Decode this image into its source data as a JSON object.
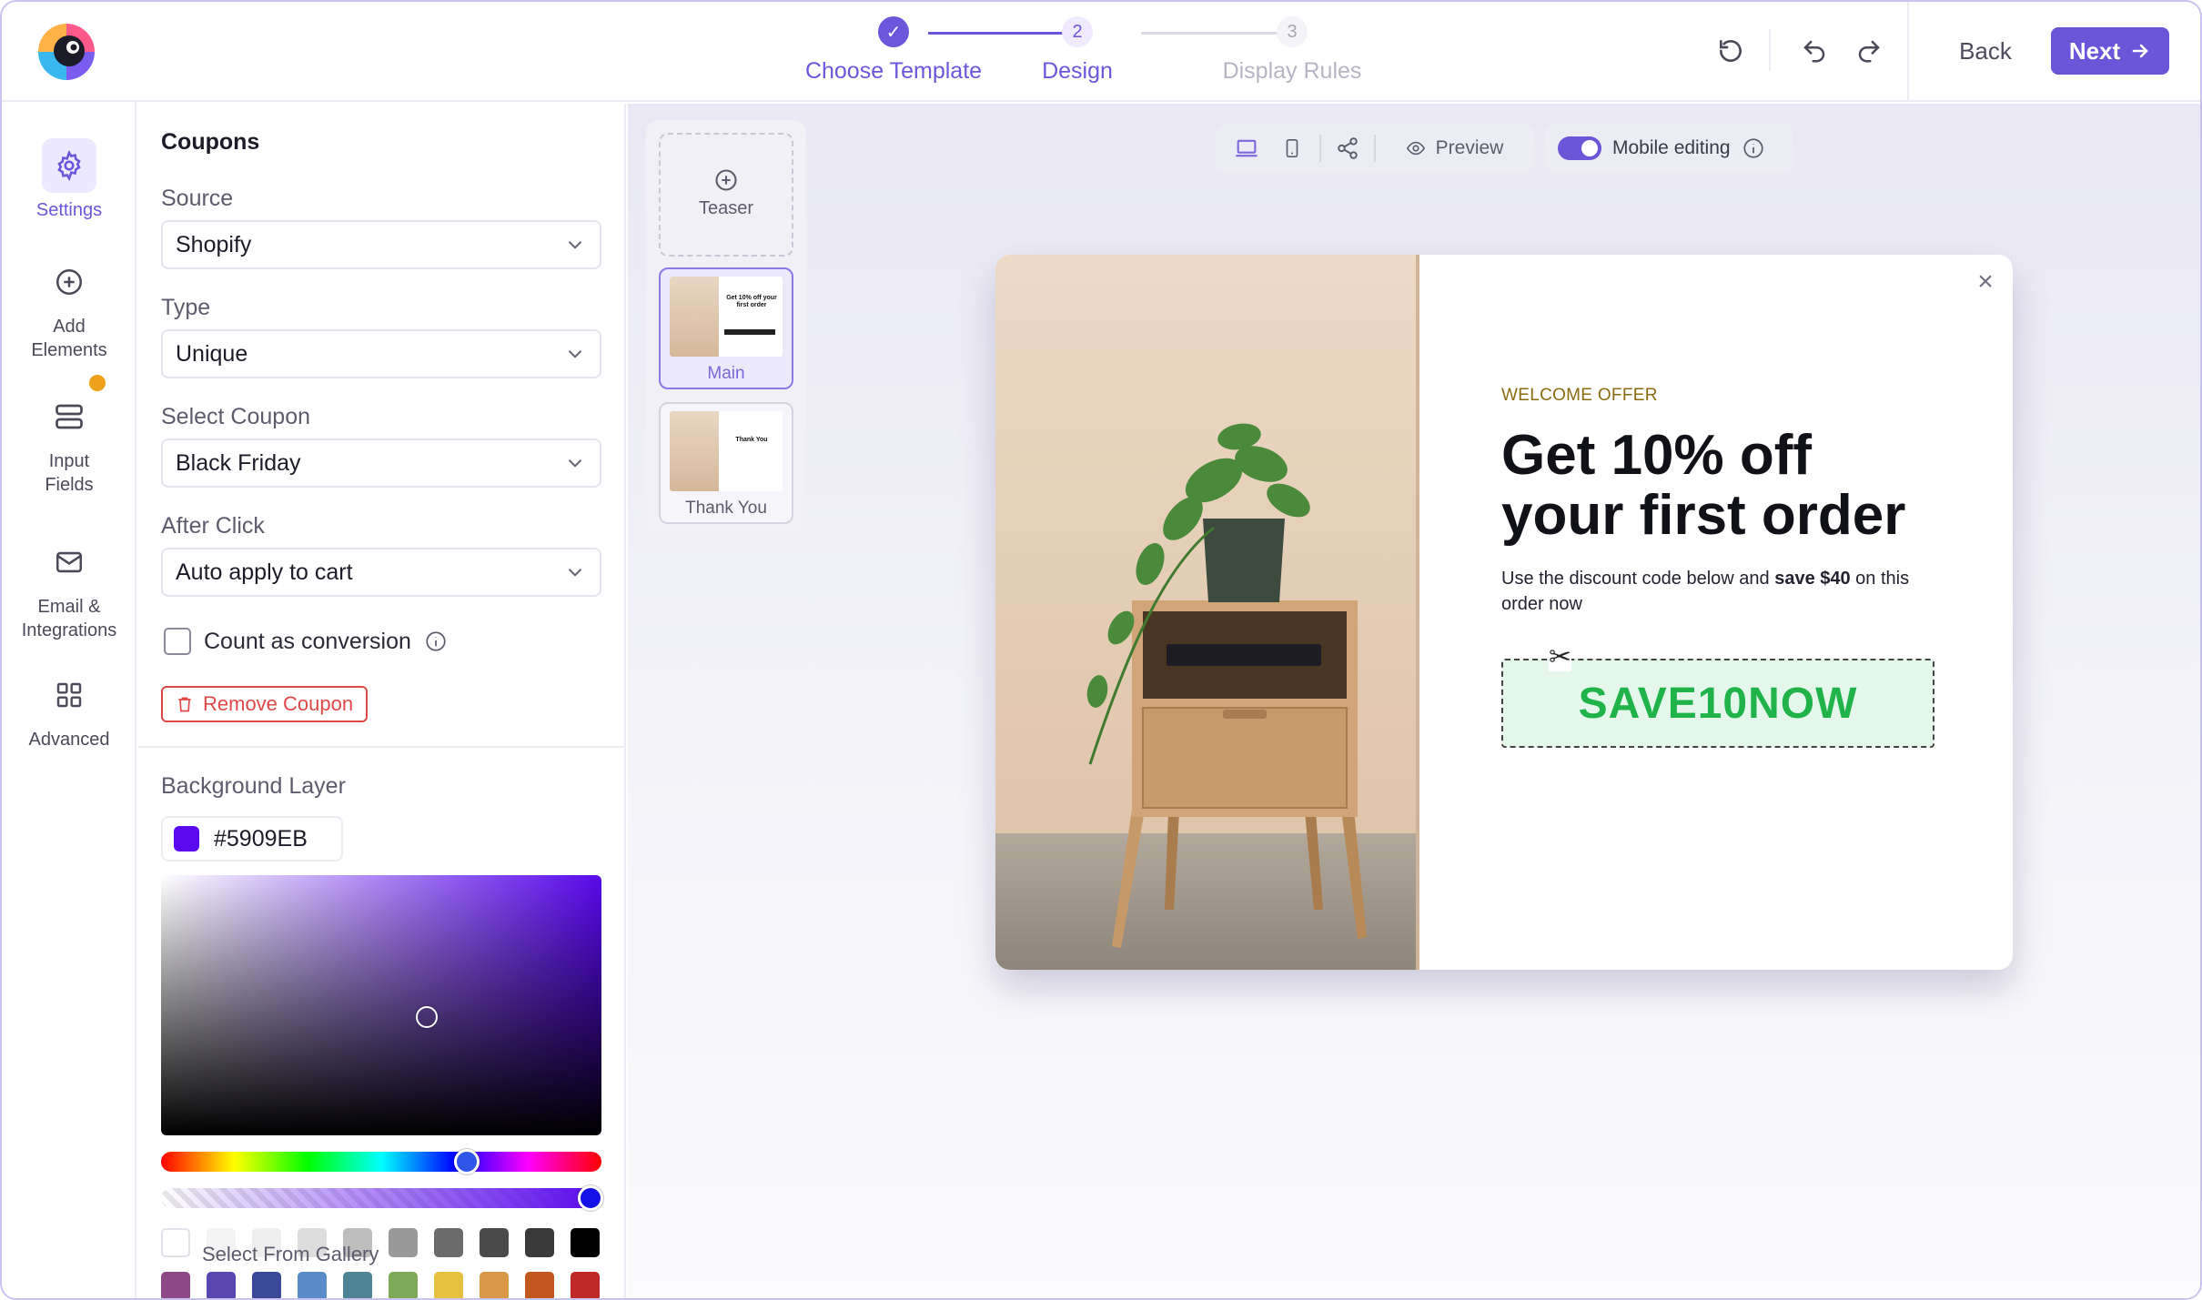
{
  "header": {
    "steps": [
      {
        "number": "✓",
        "label": "Choose Template"
      },
      {
        "number": "2",
        "label": "Design"
      },
      {
        "number": "3",
        "label": "Display Rules"
      }
    ],
    "back_label": "Back",
    "next_label": "Next",
    "icons": [
      "reset-icon",
      "undo-icon",
      "redo-icon"
    ]
  },
  "rail": {
    "items": [
      {
        "label": "Settings",
        "icon": "gear-icon"
      },
      {
        "label": "Add Elements",
        "icon": "plus-circle-icon"
      },
      {
        "label": "Input Fields",
        "icon": "input-fields-icon"
      },
      {
        "label": "Email & Integrations",
        "icon": "mail-icon"
      },
      {
        "label": "Advanced",
        "icon": "grid-icon"
      }
    ]
  },
  "panel": {
    "title": "Coupons",
    "fields": [
      {
        "label": "Source",
        "value": "Shopify"
      },
      {
        "label": "Type",
        "value": "Unique"
      },
      {
        "label": "Select Coupon",
        "value": "Black Friday"
      },
      {
        "label": "After Click",
        "value": "Auto apply to cart"
      }
    ],
    "count_conversion_label": "Count as conversion",
    "remove_coupon_label": "Remove Coupon",
    "background_layer_label": "Background Layer",
    "color_hex": "#5909EB",
    "gallery_label": "Select From Gallery",
    "swatches_row1": [
      "#ffffff",
      "#f3f3f3",
      "#eeeeee",
      "#dddddd",
      "#bdbdbd",
      "#999999",
      "#6b6b6b",
      "#4a4a4a",
      "#3a3a3a",
      "#000000"
    ],
    "swatches_row2": [
      "#8e4a86",
      "#5a48b0",
      "#3a4898",
      "#5a8cc8",
      "#4e8494",
      "#7eaa58",
      "#e8c040",
      "#d89848",
      "#c05820",
      "#c02828"
    ]
  },
  "canvas": {
    "thumbs": [
      {
        "label": "Teaser"
      },
      {
        "label": "Main"
      },
      {
        "label": "Thank You"
      }
    ],
    "preview_label": "Preview",
    "mobile_editing_label": "Mobile editing",
    "accent": "#6b55d8"
  },
  "popup": {
    "eyebrow": "WELCOME OFFER",
    "headline_line1": "Get 10% off",
    "headline_line2": "your first order",
    "body_prefix": "Use the discount code below and ",
    "body_bold": "save $40",
    "body_suffix": " on this order now",
    "coupon_code": "SAVE10NOW",
    "close_glyph": "×",
    "mini_main_text": "Get 10% off your first order",
    "mini_thanks_text": "Thank You"
  }
}
